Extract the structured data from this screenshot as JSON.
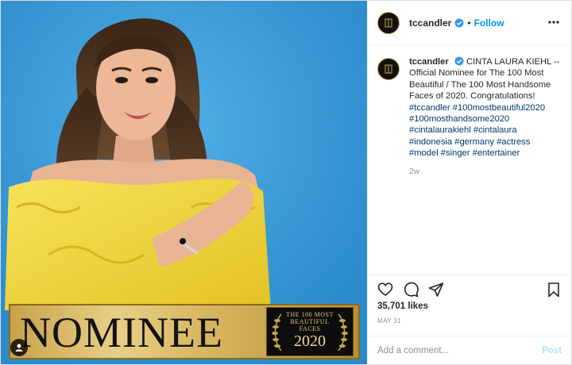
{
  "post": {
    "username": "tccandler",
    "follow_label": "Follow",
    "separator": "•",
    "caption_lines": [
      "CINTA LAURA KIEHL --",
      "Official Nominee for The 100 Most",
      "Beautiful / The 100 Most Handsome",
      "Faces of 2020. Congratulations!"
    ],
    "hashtag_lines": [
      "#tccandler #100mostbeautiful2020",
      "#100mosthandsome2020",
      "#cintalaurakiehl #cintalaura",
      "#indonesia #germany #actress",
      "#model #singer #entertainer"
    ],
    "time_ago": "2w",
    "likes": "35,701 likes",
    "date": "MAY 31"
  },
  "image": {
    "banner_word": "NOMINEE",
    "badge": {
      "line1": "THE 100 MOST",
      "line2": "BEAUTIFUL",
      "line3": "FACES",
      "line4": "2020"
    }
  },
  "comment": {
    "placeholder": "Add a comment...",
    "post_label": "Post"
  },
  "colors": {
    "background_blue": "#3da0dc",
    "dress_yellow": "#f2d83a",
    "gold": "#c8a24a",
    "link_blue": "#0095f6",
    "hashtag_blue": "#00376b"
  },
  "icons": [
    "person-tag-icon",
    "verified-icon",
    "more-options-icon",
    "heart-icon",
    "comment-icon",
    "share-icon",
    "bookmark-icon"
  ]
}
